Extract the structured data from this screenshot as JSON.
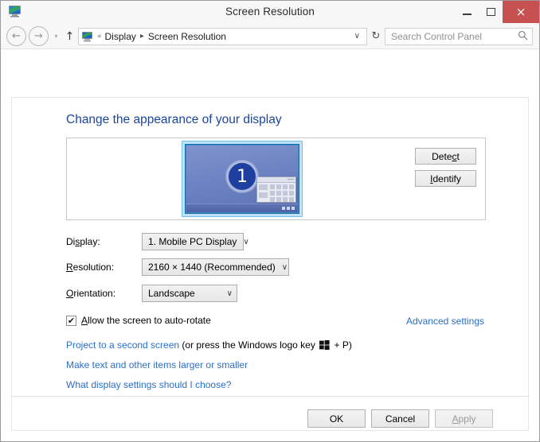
{
  "window": {
    "title": "Screen Resolution",
    "icon": "display-monitor-icon",
    "controls": {
      "minimize": "minimize-icon",
      "maximize": "maximize-icon",
      "close": "×"
    },
    "close_color": "#c75050"
  },
  "navbar": {
    "back": "←",
    "forward": "→",
    "recent_pages": "▾",
    "up": "↑",
    "address_icon": "display-monitor-icon",
    "overflow": "«",
    "breadcrumbs": [
      "Display",
      "Screen Resolution"
    ],
    "separator": "▸",
    "history_arrow": "∨",
    "refresh": "↻",
    "search_placeholder": "Search Control Panel",
    "search_value": ""
  },
  "page": {
    "heading": "Change the appearance of your display",
    "accent_link_color": "#2a6fc9",
    "heading_color": "#19459c"
  },
  "preview": {
    "monitor_number": "1",
    "buttons": [
      {
        "label": "Detect",
        "accel_before": "Dete",
        "accel": "c",
        "accel_after": "t"
      },
      {
        "label": "Identify",
        "accel_before": "",
        "accel": "I",
        "accel_after": "dentify"
      }
    ]
  },
  "form": {
    "display": {
      "label_before": "Di",
      "label_accel": "s",
      "label_after": "play:",
      "value": "1. Mobile PC Display",
      "arrow": "∨"
    },
    "resolution": {
      "label_accel": "R",
      "label_after": "esolution:",
      "value": "2160 × 1440 (Recommended)",
      "arrow": "∨"
    },
    "orientation": {
      "label_accel": "O",
      "label_after": "rientation:",
      "value": "Landscape",
      "arrow": "∨"
    },
    "autorotate": {
      "checked": true,
      "check_glyph": "✔",
      "label_accel": "A",
      "label_after": "llow the screen to auto-rotate"
    },
    "advanced_settings": "Advanced settings"
  },
  "links": {
    "project_link": "Project to a second screen",
    "project_tail_before": " (or press the Windows logo key ",
    "project_tail_after": " + P)",
    "make_text": "Make text and other items larger or smaller",
    "what_settings": "What display settings should I choose?"
  },
  "footer": {
    "ok": "OK",
    "cancel": "Cancel",
    "apply_before": "A",
    "apply_after": "pply",
    "apply_enabled": false
  }
}
